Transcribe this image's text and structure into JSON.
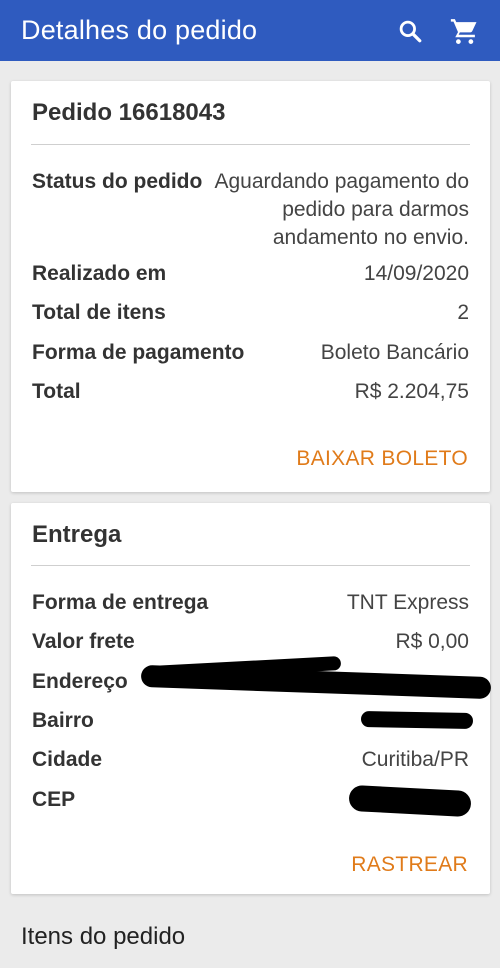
{
  "appbar": {
    "title": "Detalhes do pedido",
    "search_icon": "search-icon",
    "cart_icon": "cart-icon",
    "color": "#2f5bbf"
  },
  "order": {
    "title": "Pedido 16618043",
    "rows": [
      {
        "label": "Status do pedido",
        "value": "Aguardando pagamento do pedido para darmos andamento no envio."
      },
      {
        "label": "Realizado em",
        "value": "14/09/2020"
      },
      {
        "label": "Total de itens",
        "value": "2"
      },
      {
        "label": "Forma de pagamento",
        "value": "Boleto Bancário"
      },
      {
        "label": "Total",
        "value": "R$ 2.204,75"
      }
    ],
    "action": "BAIXAR BOLETO"
  },
  "delivery": {
    "title": "Entrega",
    "rows": [
      {
        "label": "Forma de entrega",
        "value": "TNT Express"
      },
      {
        "label": "Valor frete",
        "value": "R$ 0,00"
      },
      {
        "label": "Endereço",
        "value": ""
      },
      {
        "label": "Bairro",
        "value": ""
      },
      {
        "label": "Cidade",
        "value": "Curitiba/PR"
      },
      {
        "label": "CEP",
        "value": ""
      }
    ],
    "action": "RASTREAR"
  },
  "items_section": {
    "title": "Itens do pedido"
  },
  "colors": {
    "accent": "#e07b1a",
    "background": "#ebebeb"
  }
}
